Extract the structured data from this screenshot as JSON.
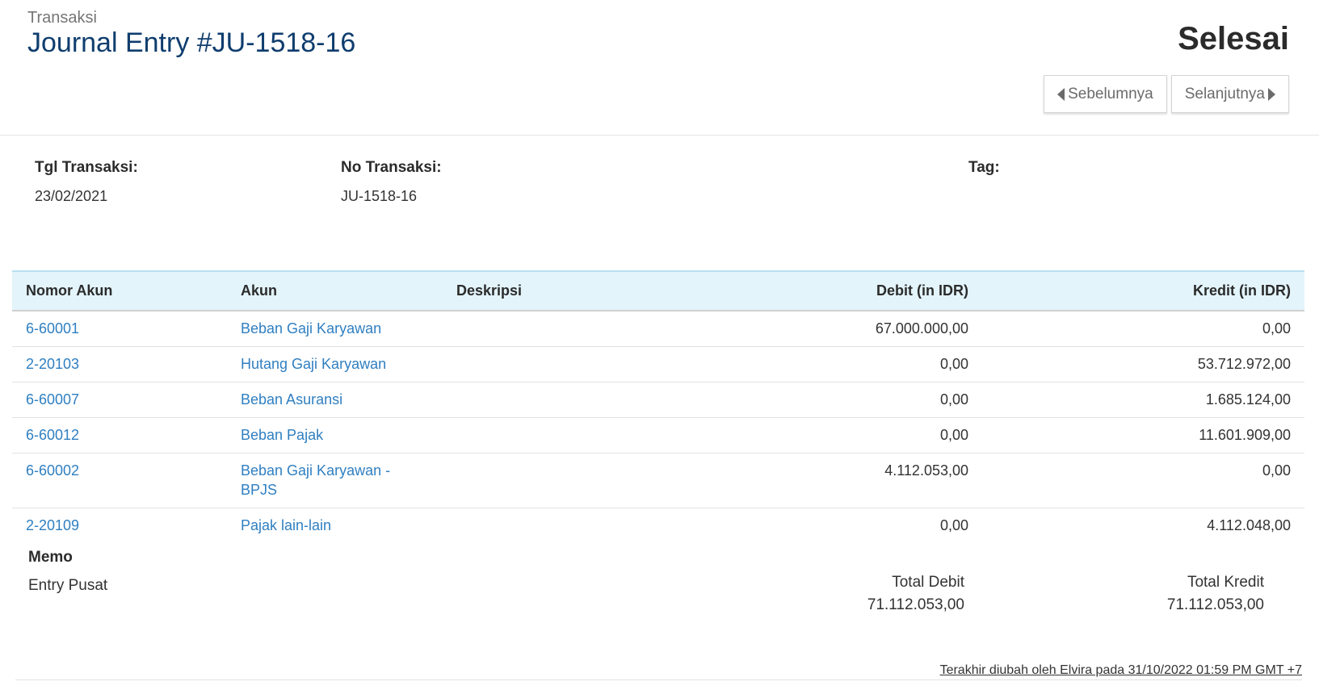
{
  "header": {
    "breadcrumb": "Transaksi",
    "title": "Journal Entry #JU-1518-16",
    "status": "Selesai",
    "prev_label": "Sebelumnya",
    "next_label": "Selanjutnya"
  },
  "info": {
    "date_label": "Tgl Transaksi:",
    "date_value": "23/02/2021",
    "number_label": "No Transaksi:",
    "number_value": "JU-1518-16",
    "tag_label": "Tag:"
  },
  "table": {
    "headers": {
      "account_no": "Nomor Akun",
      "account": "Akun",
      "description": "Deskripsi",
      "debit": "Debit (in IDR)",
      "credit": "Kredit (in IDR)"
    },
    "rows": [
      {
        "account_no": "6-60001",
        "account": "Beban Gaji Karyawan",
        "description": "",
        "debit": "67.000.000,00",
        "credit": "0,00"
      },
      {
        "account_no": "2-20103",
        "account": "Hutang Gaji Karyawan",
        "description": "",
        "debit": "0,00",
        "credit": "53.712.972,00"
      },
      {
        "account_no": "6-60007",
        "account": "Beban Asuransi",
        "description": "",
        "debit": "0,00",
        "credit": "1.685.124,00"
      },
      {
        "account_no": "6-60012",
        "account": "Beban Pajak",
        "description": "",
        "debit": "0,00",
        "credit": "11.601.909,00"
      },
      {
        "account_no": "6-60002",
        "account": "Beban Gaji Karyawan - BPJS",
        "description": "",
        "debit": "4.112.053,00",
        "credit": "0,00"
      },
      {
        "account_no": "2-20109",
        "account": "Pajak lain-lain",
        "description": "",
        "debit": "0,00",
        "credit": "4.112.048,00"
      }
    ]
  },
  "memo": {
    "label": "Memo",
    "value": "Entry Pusat"
  },
  "totals": {
    "debit_label": "Total Debit",
    "debit_value": "71.112.053,00",
    "credit_label": "Total Kredit",
    "credit_value": "71.112.053,00"
  },
  "footer": {
    "last_modified": "Terakhir diubah oleh Elvira pada 31/10/2022 01:59 PM GMT +7"
  },
  "colors": {
    "title": "#0f3d6e",
    "link": "#2f7fc1",
    "table_header_bg": "#e3f4fb"
  }
}
